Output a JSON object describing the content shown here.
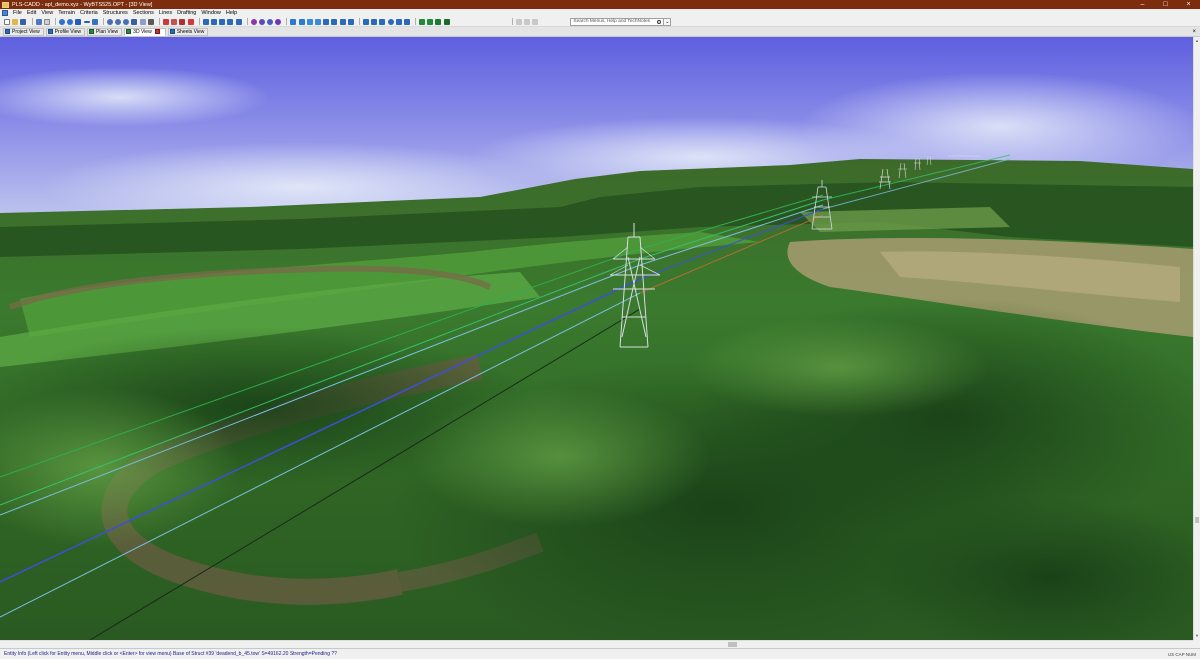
{
  "window": {
    "title": "PLS-CADD - apl_demo.xyz - WyBTS525.OPT - [3D View]"
  },
  "menu": {
    "items": [
      "File",
      "Edit",
      "View",
      "Terrain",
      "Criteria",
      "Structures",
      "Sections",
      "Lines",
      "Drafting",
      "Window",
      "Help"
    ]
  },
  "toolbar": {
    "search_placeholder": "Search Menus, Help and TechNotes"
  },
  "tabs": [
    {
      "label": "Project View",
      "icon": "project-icon",
      "active": false
    },
    {
      "label": "Profile View",
      "icon": "profile-icon",
      "active": false
    },
    {
      "label": "Plan View",
      "icon": "plan-icon",
      "active": false
    },
    {
      "label": "3D View",
      "icon": "3d-view-icon",
      "active": true
    },
    {
      "label": "Sheets View",
      "icon": "sheets-icon",
      "active": false
    }
  ],
  "status": {
    "text": "Entity Info (Left click for Entity menu, Middle click or <Enter> for view menu)  Base of Struct #39 'deadend_b_45.tow' S=49162.20 Strength=Pending  ??",
    "indicators": "US  CAP  NUM"
  },
  "colors": {
    "title_bar": "#7d2d0e",
    "sky_top": "#5d5fe0",
    "terrain": "#3f7a2c",
    "status_text": "#1a1a8a"
  }
}
